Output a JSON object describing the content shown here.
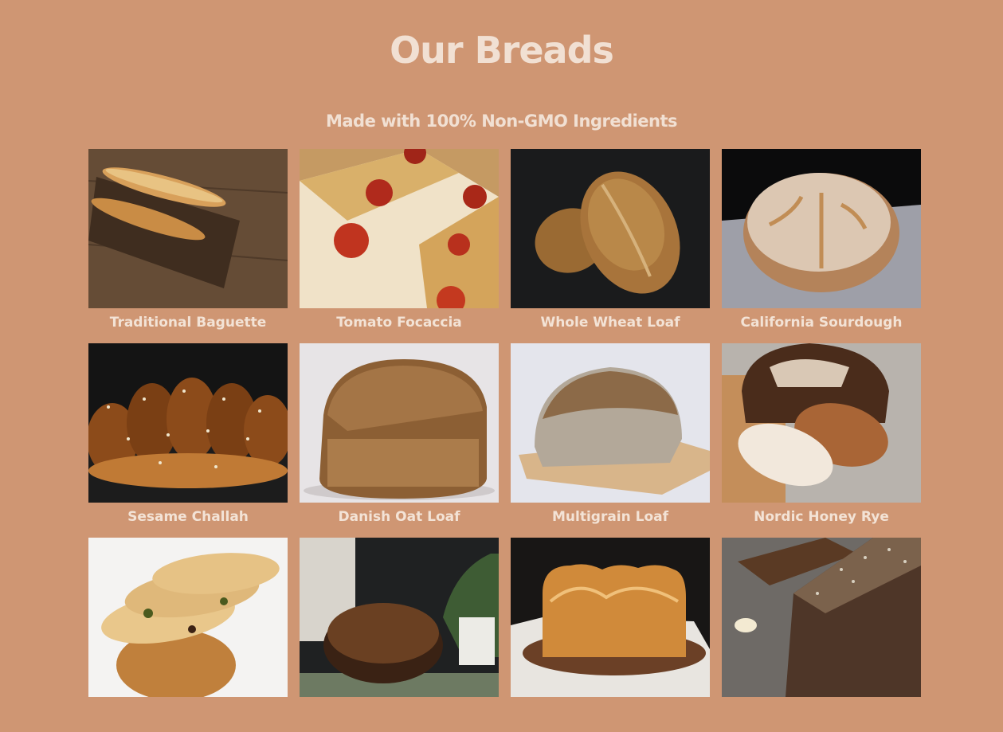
{
  "page": {
    "title": "Our Breads",
    "subtitle": "Made with 100% Non-GMO Ingredients"
  },
  "colors": {
    "background": "#cf9673",
    "text": "#f1e0d3"
  },
  "breads": [
    {
      "name": "Traditional Baguette",
      "photo": "baguette-photo"
    },
    {
      "name": "Tomato Focaccia",
      "photo": "focaccia-photo"
    },
    {
      "name": "Whole Wheat Loaf",
      "photo": "whole-wheat-photo"
    },
    {
      "name": "California Sourdough",
      "photo": "sourdough-photo"
    },
    {
      "name": "Sesame Challah",
      "photo": "challah-photo"
    },
    {
      "name": "Danish Oat Loaf",
      "photo": "oat-loaf-photo"
    },
    {
      "name": "Multigrain Loaf",
      "photo": "multigrain-photo"
    },
    {
      "name": "Nordic Honey Rye",
      "photo": "honey-rye-photo"
    },
    {
      "name": "",
      "photo": "olive-bread-photo"
    },
    {
      "name": "",
      "photo": "seeded-boule-photo"
    },
    {
      "name": "",
      "photo": "milk-bread-photo"
    },
    {
      "name": "",
      "photo": "seeded-rye-photo"
    }
  ]
}
